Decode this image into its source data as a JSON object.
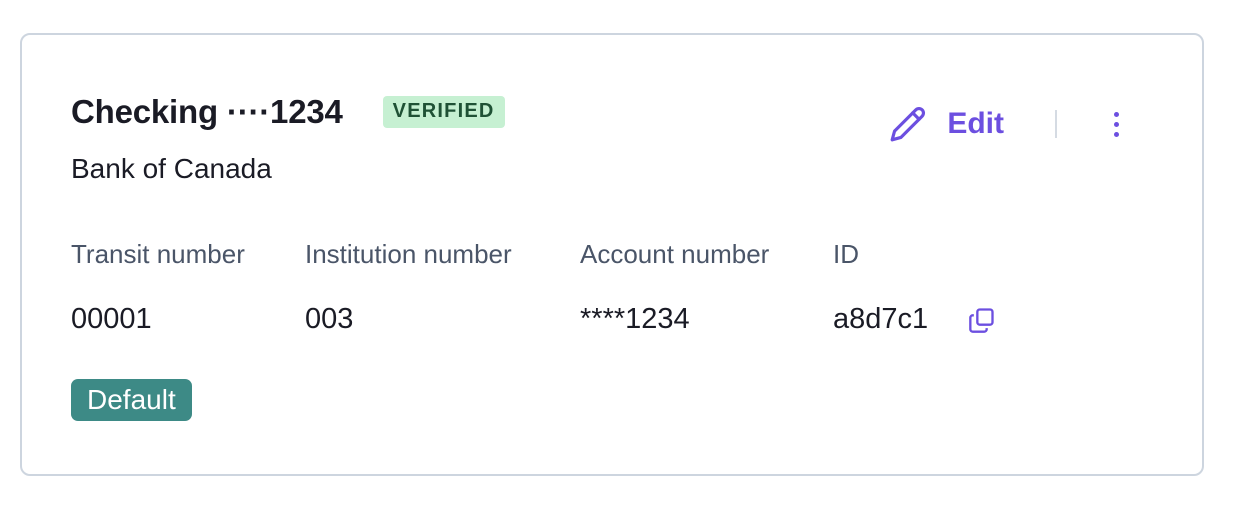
{
  "account": {
    "title": "Checking ····1234",
    "status_badge": "VERIFIED",
    "bank_name": "Bank of Canada",
    "default_badge": "Default"
  },
  "actions": {
    "edit_label": "Edit",
    "edit_icon": "pencil-icon",
    "more_icon": "more-vertical-icon"
  },
  "fields": [
    {
      "label": "Transit number",
      "value": "00001"
    },
    {
      "label": "Institution number",
      "value": "003"
    },
    {
      "label": "Account number",
      "value": "****1234"
    },
    {
      "label": "ID",
      "value": "a8d7c1",
      "action_icon": "copy-icon"
    }
  ],
  "colors": {
    "accent": "#6c4fe0",
    "verified_bg": "#c6f0d2",
    "verified_text": "#1f5135",
    "default_bg": "#3d8a86",
    "border": "#cdd5df"
  }
}
